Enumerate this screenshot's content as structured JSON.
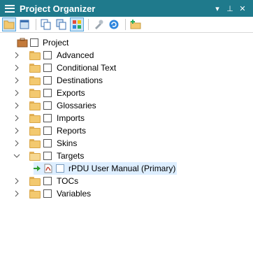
{
  "title": "Project Organizer",
  "titlebar_buttons": {
    "dropdown": "▾",
    "pin": "⊥",
    "close": "✕"
  },
  "toolbar": {
    "buttons": [
      "folder-open-icon",
      "view-icon",
      "copy-icon",
      "duplicate-icon",
      "grid-view-icon",
      "tools-icon",
      "refresh-icon",
      "add-folder-icon"
    ]
  },
  "tree": {
    "root": "Project",
    "items": [
      {
        "label": "Advanced"
      },
      {
        "label": "Conditional Text"
      },
      {
        "label": "Destinations"
      },
      {
        "label": "Exports"
      },
      {
        "label": "Glossaries"
      },
      {
        "label": "Imports"
      },
      {
        "label": "Reports"
      },
      {
        "label": "Skins"
      },
      {
        "label": "Targets"
      },
      {
        "label": "rPDU User Manual (Primary)"
      },
      {
        "label": "TOCs"
      },
      {
        "label": "Variables"
      }
    ]
  },
  "colors": {
    "titlebar": "#1f7a8c",
    "selection": "#ddeeff",
    "folder": "#f3c96f",
    "primary_arrow": "#2e9c2e",
    "pdf_red": "#c0392b"
  }
}
